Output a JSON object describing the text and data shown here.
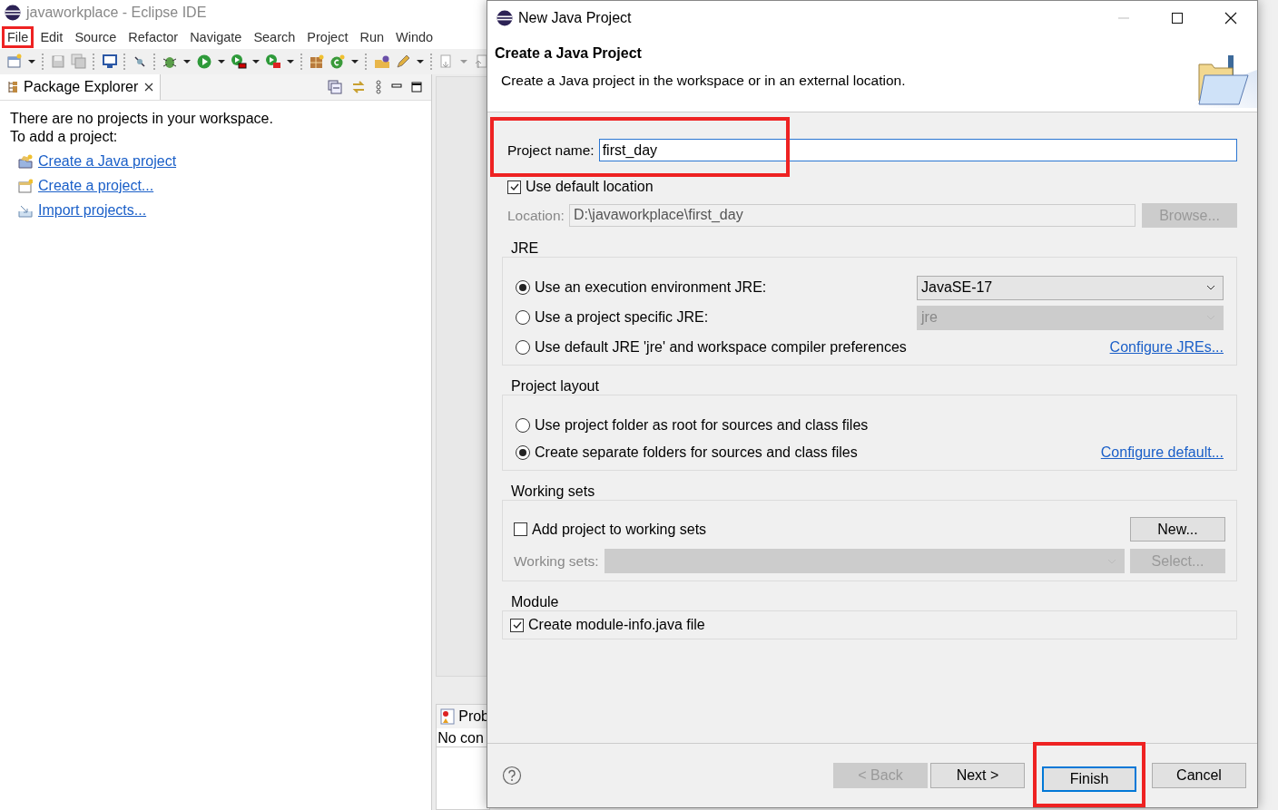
{
  "ide": {
    "title": "javaworkplace - Eclipse IDE",
    "menu": [
      {
        "label": "File",
        "highlighted": true
      },
      {
        "label": "Edit",
        "highlighted": false
      },
      {
        "label": "Source",
        "highlighted": false
      },
      {
        "label": "Refactor",
        "highlighted": false
      },
      {
        "label": "Navigate",
        "highlighted": false
      },
      {
        "label": "Search",
        "highlighted": false
      },
      {
        "label": "Project",
        "highlighted": false
      },
      {
        "label": "Run",
        "highlighted": false
      },
      {
        "label": "Windo",
        "highlighted": false
      }
    ],
    "package_explorer": {
      "tab": "Package Explorer",
      "message": "There are no projects in your workspace.",
      "prompt": "To add a project:",
      "links": [
        {
          "kind": "java",
          "label": "Create a Java project"
        },
        {
          "kind": "project",
          "label": "Create a project..."
        },
        {
          "kind": "import",
          "label": "Import projects..."
        }
      ]
    },
    "problems": {
      "tab": "Prob",
      "text": "No con"
    }
  },
  "dialog": {
    "title": "New Java Project",
    "heading": "Create a Java Project",
    "description": "Create a Java project in the workspace or in an external location.",
    "project_name": {
      "label": "Project name:",
      "value": "first_day",
      "highlighted": true
    },
    "use_default_location": {
      "label": "Use default location",
      "checked": true
    },
    "location": {
      "label": "Location:",
      "value": "D:\\javaworkplace\\first_day",
      "disabled": true
    },
    "browse": {
      "label": "Browse...",
      "disabled": true
    },
    "jre": {
      "title": "JRE",
      "options": [
        {
          "label": "Use an execution environment JRE:",
          "selected": true,
          "dropdown": {
            "value": "JavaSE-17",
            "disabled": false
          }
        },
        {
          "label": "Use a project specific JRE:",
          "selected": false,
          "dropdown": {
            "value": "jre",
            "disabled": true
          }
        },
        {
          "label": "Use default JRE 'jre' and workspace compiler preferences",
          "selected": false,
          "link": "Configure JREs..."
        }
      ]
    },
    "project_layout": {
      "title": "Project layout",
      "options": [
        {
          "label": "Use project folder as root for sources and class files",
          "selected": false
        },
        {
          "label": "Create separate folders for sources and class files",
          "selected": true,
          "link": "Configure default..."
        }
      ]
    },
    "working_sets": {
      "title": "Working sets",
      "add": {
        "label": "Add project to working sets",
        "checked": false
      },
      "new_button": {
        "label": "New...",
        "disabled": false
      },
      "sets": {
        "label": "Working sets:",
        "disabled": true
      },
      "select_button": {
        "label": "Select...",
        "disabled": true
      }
    },
    "module": {
      "title": "Module",
      "create": {
        "label": "Create module-info.java file",
        "checked": true
      }
    },
    "buttons": [
      {
        "label": "< Back",
        "disabled": true,
        "default": false,
        "highlighted": false
      },
      {
        "label": "Next >",
        "disabled": false,
        "default": false,
        "highlighted": false
      },
      {
        "label": "Finish",
        "disabled": false,
        "default": true,
        "highlighted": true
      },
      {
        "label": "Cancel",
        "disabled": false,
        "default": false,
        "highlighted": false
      }
    ]
  }
}
